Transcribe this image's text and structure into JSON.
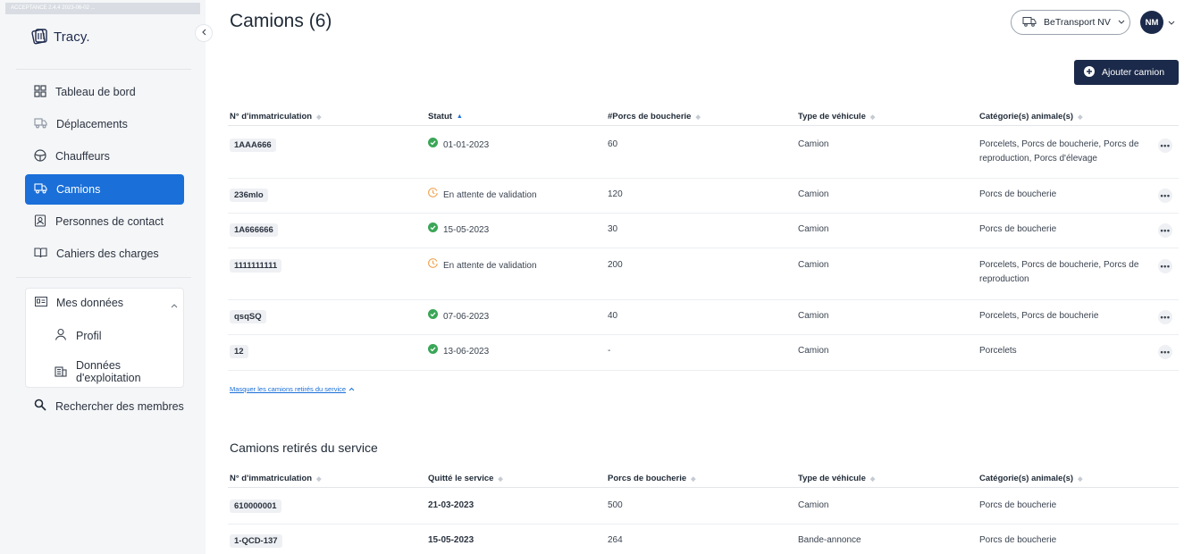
{
  "app": {
    "env_banner": "ACCEPTANCE 2.4.4 2023-06-02 ...",
    "logo_text": "Tracy."
  },
  "sidebar": {
    "items": [
      {
        "label": "Tableau de bord",
        "icon": "dashboard-icon"
      },
      {
        "label": "Déplacements",
        "icon": "truck-icon"
      },
      {
        "label": "Chauffeurs",
        "icon": "steering-wheel-icon"
      },
      {
        "label": "Camions",
        "icon": "truck-icon",
        "active": true
      },
      {
        "label": "Personnes de contact",
        "icon": "contact-card-icon"
      },
      {
        "label": "Cahiers des charges",
        "icon": "book-icon"
      }
    ],
    "my_data": {
      "label": "Mes données",
      "items": [
        {
          "label": "Profil",
          "icon": "user-icon"
        },
        {
          "label": "Données d'exploitation",
          "icon": "building-icon"
        }
      ]
    },
    "search_label": "Rechercher des membres"
  },
  "header": {
    "title": "Camions (6)",
    "company": "BeTransport NV",
    "avatar_initials": "NM",
    "add_button": "Ajouter camion"
  },
  "trucks_table": {
    "columns": [
      "N° d'immatriculation",
      "Statut",
      "#Porcs de boucherie",
      "Type de véhicule",
      "Catégorie(s) animale(s)"
    ],
    "rows": [
      {
        "plate": "1AAA666",
        "status": "01-01-2023",
        "status_kind": "ok",
        "count": "60",
        "type": "Camion",
        "categories": "Porcelets, Porcs de boucherie, Porcs de reproduction, Porcs d'élevage"
      },
      {
        "plate": "236mlo",
        "status": "En attente de validation",
        "status_kind": "pending",
        "count": "120",
        "type": "Camion",
        "categories": "Porcs de boucherie"
      },
      {
        "plate": "1A666666",
        "status": "15-05-2023",
        "status_kind": "ok",
        "count": "30",
        "type": "Camion",
        "categories": "Porcs de boucherie"
      },
      {
        "plate": "1111111111",
        "status": "En attente de validation",
        "status_kind": "pending",
        "count": "200",
        "type": "Camion",
        "categories": "Porcelets, Porcs de boucherie, Porcs de reproduction"
      },
      {
        "plate": "qsqSQ",
        "status": "07-06-2023",
        "status_kind": "ok",
        "count": "40",
        "type": "Camion",
        "categories": "Porcelets, Porcs de boucherie"
      },
      {
        "plate": "12",
        "status": "13-06-2023",
        "status_kind": "ok",
        "count": "-",
        "type": "Camion",
        "categories": "Porcelets"
      }
    ]
  },
  "toggle_link": "Masquer les camions retirés du service",
  "retired": {
    "title": "Camions retirés du service",
    "columns": [
      "N° d'immatriculation",
      "Quitté le service",
      "Porcs de boucherie",
      "Type de véhicule",
      "Catégorie(s) animale(s)"
    ],
    "rows": [
      {
        "plate": "610000001",
        "left": "21-03-2023",
        "count": "500",
        "type": "Camion",
        "categories": "Porcs de boucherie"
      },
      {
        "plate": "1-QCD-137",
        "left": "15-05-2023",
        "count": "264",
        "type": "Bande-annonce",
        "categories": "Porcs de boucherie"
      }
    ]
  },
  "colors": {
    "accent": "#1a6fd8",
    "navy": "#1b2a4a",
    "ok_green": "#3aa657",
    "pending_orange": "#f0a04b"
  }
}
